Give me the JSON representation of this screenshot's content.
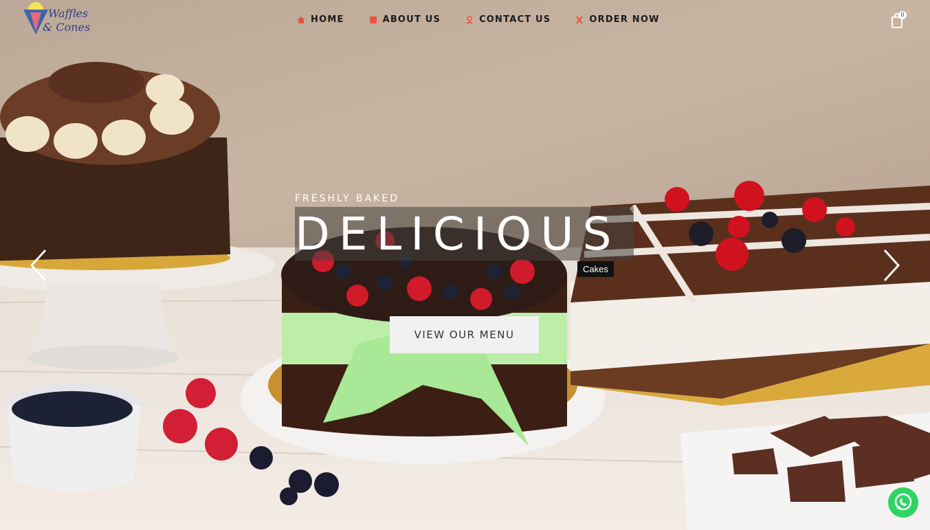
{
  "brand": {
    "line1": "Waffles",
    "line2": "& Cones",
    "icon": "ice-cream-cone-logo"
  },
  "nav": {
    "items": [
      {
        "label": "HOME",
        "icon": "home-icon"
      },
      {
        "label": "ABOUT US",
        "icon": "book-icon"
      },
      {
        "label": "CONTACT US",
        "icon": "person-icon"
      },
      {
        "label": "ORDER NOW",
        "icon": "utensils-icon"
      }
    ],
    "cart_count": "0",
    "cart_icon": "shopping-bag-icon"
  },
  "hero": {
    "eyebrow": "FRESHLY BAKED",
    "headline": "DELICIOUS",
    "tag": "Cakes",
    "cta_label": "VIEW OUR MENU",
    "prev_icon": "chevron-left-icon",
    "next_icon": "chevron-right-icon"
  },
  "chat": {
    "icon": "whatsapp-icon"
  },
  "colors": {
    "accent": "#e8533f",
    "nav_text": "#1b1b1b",
    "whatsapp": "#2fd366"
  }
}
